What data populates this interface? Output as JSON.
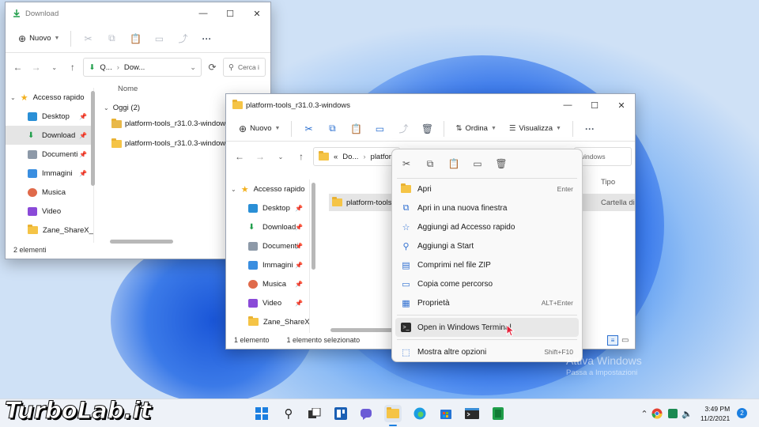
{
  "back_window": {
    "title": "Download",
    "new_label": "Nuovo",
    "address": [
      "Q...",
      "Dow..."
    ],
    "search_placeholder": "Cerca i",
    "column_name": "Nome",
    "group_label": "Oggi (2)",
    "files": [
      "platform-tools_r31.0.3-windows",
      "platform-tools_r31.0.3-windows"
    ],
    "sidebar": {
      "header": "Accesso rapido",
      "items": [
        "Desktop",
        "Download",
        "Documenti",
        "Immagini",
        "Musica",
        "Video",
        "Zane_ShareX_Sc"
      ]
    },
    "status": "2 elementi"
  },
  "front_window": {
    "title": "platform-tools_r31.0.3-windows",
    "new_label": "Nuovo",
    "sort_label": "Ordina",
    "view_label": "Visualizza",
    "address": [
      "«",
      "Do...",
      "platfor..."
    ],
    "search_text": "windows",
    "column_type": "Tipo",
    "selected_item": "platform-tools",
    "selected_type": "Cartella di",
    "sidebar": {
      "header": "Accesso rapido",
      "items": [
        "Desktop",
        "Download",
        "Documenti",
        "Immagini",
        "Musica",
        "Video",
        "Zane_ShareX_Sc"
      ]
    },
    "status_count": "1 elemento",
    "status_selected": "1 elemento selezionato"
  },
  "context_menu": {
    "items": [
      {
        "label": "Apri",
        "shortcut": "Enter",
        "icon": "folder-open-icon"
      },
      {
        "label": "Apri in una nuova finestra",
        "shortcut": "",
        "icon": "new-window-icon"
      },
      {
        "label": "Aggiungi ad Accesso rapido",
        "shortcut": "",
        "icon": "star-icon"
      },
      {
        "label": "Aggiungi a Start",
        "shortcut": "",
        "icon": "pin-icon"
      },
      {
        "label": "Comprimi nel file ZIP",
        "shortcut": "",
        "icon": "zip-icon"
      },
      {
        "label": "Copia come percorso",
        "shortcut": "",
        "icon": "path-icon"
      },
      {
        "label": "Proprietà",
        "shortcut": "ALT+Enter",
        "icon": "properties-icon"
      }
    ],
    "terminal": {
      "label": "Open in Windows Terminal",
      "icon": "terminal-icon"
    },
    "more": {
      "label": "Mostra altre opzioni",
      "shortcut": "Shift+F10",
      "icon": "more-options-icon"
    }
  },
  "watermark": {
    "line1": "Attiva Windows",
    "line2": "Passa a Impostazioni"
  },
  "logo": "TurboLab.it",
  "taskbar": {
    "time": "3:49 PM",
    "date": "11/2/2021",
    "notifications": "2"
  },
  "colors": {
    "accent": "#0067c0",
    "folder": "#f5c446",
    "desktop_blue": "#1f66e0"
  }
}
